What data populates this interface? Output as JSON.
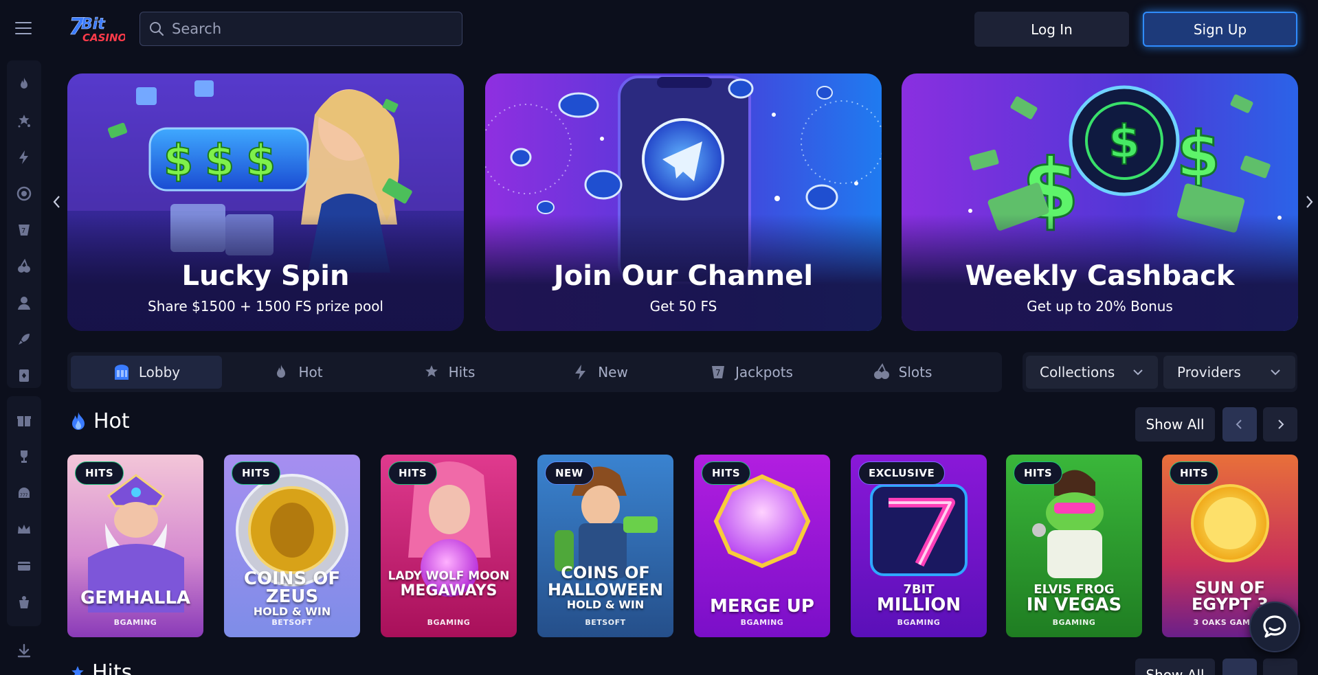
{
  "header": {
    "logo_text": "7BIT CASINO",
    "search_placeholder": "Search",
    "login_label": "Log In",
    "signup_label": "Sign Up"
  },
  "sidebar": {
    "items": [
      "fire-icon",
      "stars-icon",
      "lightning-icon",
      "target-icon",
      "jackpot-icon",
      "cherries-icon",
      "dealer-icon",
      "rocket-icon",
      "cards-icon"
    ],
    "items2": [
      "gift-icon",
      "trophy-icon",
      "lottery-icon",
      "crown-icon",
      "wallet-icon",
      "vip-icon"
    ],
    "bottom": "download-icon"
  },
  "banners": [
    {
      "title": "Lucky Spin",
      "subtitle": "Share $1500 + 1500 FS prize pool"
    },
    {
      "title": "Join Our Channel",
      "subtitle": "Get 50 FS"
    },
    {
      "title": "Weekly Cashback",
      "subtitle": "Get up to 20% Bonus"
    }
  ],
  "tabs": [
    {
      "label": "Lobby",
      "icon": "lobby-icon",
      "active": true
    },
    {
      "label": "Hot",
      "icon": "fire-icon"
    },
    {
      "label": "Hits",
      "icon": "stars-icon"
    },
    {
      "label": "New",
      "icon": "lightning-icon"
    },
    {
      "label": "Jackpots",
      "icon": "jackpot-icon"
    },
    {
      "label": "Slots",
      "icon": "cherries-icon"
    }
  ],
  "filters": {
    "collections": "Collections",
    "providers": "Providers"
  },
  "section_hot": {
    "title": "Hot",
    "show_all": "Show All"
  },
  "games": [
    {
      "badge": "HITS",
      "title": "GEMHALLA",
      "sub": "",
      "provider": "BGAMING"
    },
    {
      "badge": "HITS",
      "title": "COINS OF ZEUS",
      "sub": "HOLD & WIN",
      "provider": "BETSOFT"
    },
    {
      "badge": "HITS",
      "title": "LADY WOLF MOON",
      "sub": "MEGAWAYS",
      "provider": "BGAMING"
    },
    {
      "badge": "NEW",
      "title": "COINS OF HALLOWEEN",
      "sub": "HOLD & WIN",
      "provider": "BETSOFT"
    },
    {
      "badge": "HITS",
      "title": "MERGE UP",
      "sub": "",
      "provider": "BGAMING"
    },
    {
      "badge": "EXCLUSIVE",
      "title": "7BIT",
      "sub": "MILLION",
      "provider": "BGAMING"
    },
    {
      "badge": "HITS",
      "title": "ELVIS FROG",
      "sub": "IN VEGAS",
      "provider": "BGAMING"
    },
    {
      "badge": "HITS",
      "title": "SUN OF EGYPT 3",
      "sub": "",
      "provider": "3 OAKS GAMING"
    }
  ],
  "section_hits": {
    "title": "Hits",
    "show_all": "Show All"
  },
  "colors": {
    "background": "#0c0f1c",
    "accent": "#2f8cff",
    "badge_green": "#1ec27e"
  }
}
